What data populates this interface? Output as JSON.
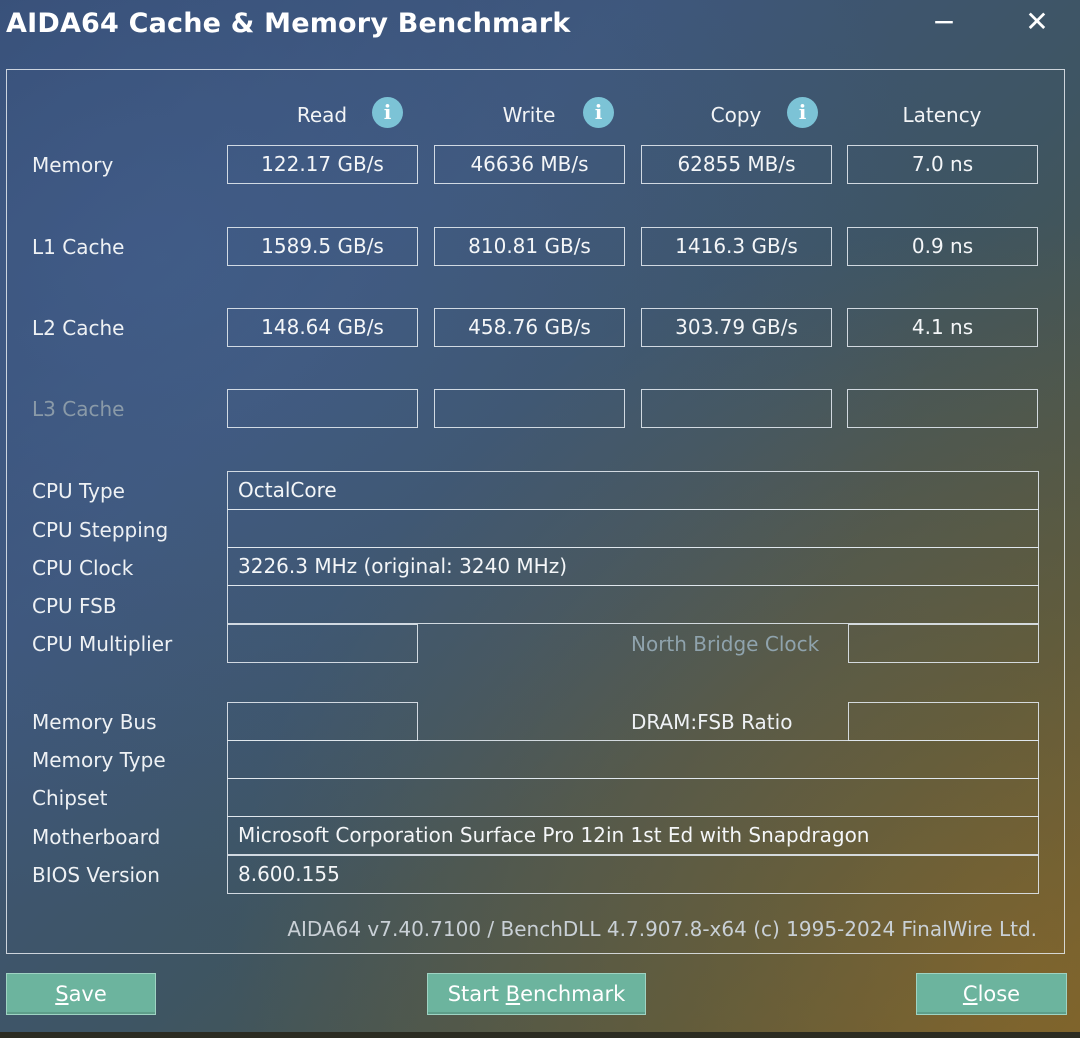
{
  "window": {
    "title": "AIDA64 Cache & Memory Benchmark",
    "minimize_glyph": "−",
    "close_glyph": "✕"
  },
  "columns": {
    "read": "Read",
    "write": "Write",
    "copy": "Copy",
    "latency": "Latency",
    "info_glyph": "i"
  },
  "bench_rows": [
    {
      "label": "Memory",
      "read": "122.17 GB/s",
      "write": "46636 MB/s",
      "copy": "62855 MB/s",
      "latency": "7.0 ns"
    },
    {
      "label": "L1 Cache",
      "read": "1589.5 GB/s",
      "write": "810.81 GB/s",
      "copy": "1416.3 GB/s",
      "latency": "0.9 ns"
    },
    {
      "label": "L2 Cache",
      "read": "148.64 GB/s",
      "write": "458.76 GB/s",
      "copy": "303.79 GB/s",
      "latency": "4.1 ns"
    },
    {
      "label": "L3 Cache",
      "read": "",
      "write": "",
      "copy": "",
      "latency": ""
    }
  ],
  "info": {
    "cpu_type": {
      "label": "CPU Type",
      "value": "OctalCore"
    },
    "cpu_stepping": {
      "label": "CPU Stepping",
      "value": ""
    },
    "cpu_clock": {
      "label": "CPU Clock",
      "value": "3226.3 MHz  (original: 3240 MHz)"
    },
    "cpu_fsb": {
      "label": "CPU FSB",
      "value": ""
    },
    "cpu_multiplier": {
      "label": "CPU Multiplier",
      "value": ""
    },
    "north_bridge": {
      "label": "North Bridge Clock",
      "value": ""
    },
    "memory_bus": {
      "label": "Memory Bus",
      "value": ""
    },
    "dram_fsb": {
      "label": "DRAM:FSB Ratio",
      "value": ""
    },
    "memory_type": {
      "label": "Memory Type",
      "value": ""
    },
    "chipset": {
      "label": "Chipset",
      "value": ""
    },
    "motherboard": {
      "label": "Motherboard",
      "value": "Microsoft Corporation Surface Pro 12in 1st Ed with Snapdragon"
    },
    "bios_version": {
      "label": "BIOS Version",
      "value": "8.600.155"
    }
  },
  "footer": {
    "version": "AIDA64 v7.40.7100 / BenchDLL 4.7.907.8-x64  (c) 1995-2024 FinalWire Ltd."
  },
  "buttons": {
    "save_pre": "",
    "save_key": "S",
    "save_post": "ave",
    "start_pre": "Start ",
    "start_key": "B",
    "start_post": "enchmark",
    "close_pre": "",
    "close_key": "C",
    "close_post": "lose"
  },
  "colors": {
    "button_bg": "#6cb49e",
    "info_icon": "#7cc3d6",
    "dim_label": "#8a9aa8"
  }
}
